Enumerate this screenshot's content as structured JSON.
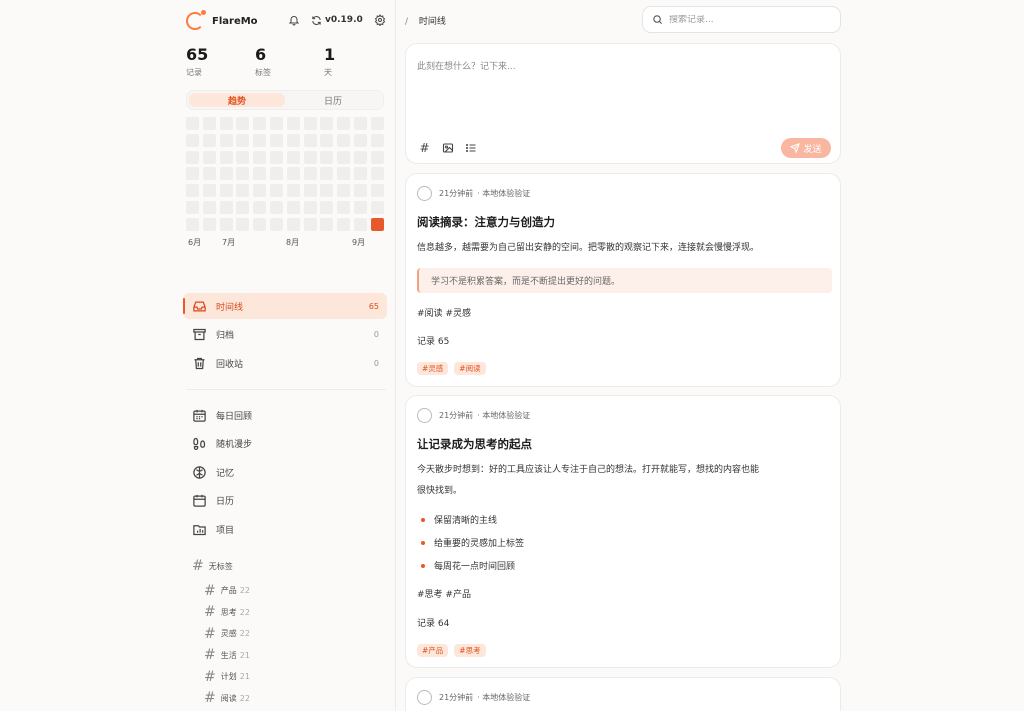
{
  "app": {
    "name": "FlareMo",
    "version": "v0.19.0"
  },
  "stats": [
    {
      "num": "65",
      "label": "记录"
    },
    {
      "num": "6",
      "label": "标签"
    },
    {
      "num": "1",
      "label": "天"
    }
  ],
  "view_toggle": {
    "trend": "趋势",
    "calendar": "日历"
  },
  "heatmap": {
    "hot_index": 83,
    "rows": 7,
    "cols": 12
  },
  "months": [
    "6月",
    "7月",
    "8月",
    "9月"
  ],
  "nav": [
    {
      "label": "时间线",
      "count": "65"
    },
    {
      "label": "归档",
      "count": "0"
    },
    {
      "label": "回收站",
      "count": "0"
    }
  ],
  "tools": [
    "每日回顾",
    "随机漫步",
    "记忆",
    "日历",
    "项目"
  ],
  "tags": {
    "heading": "无标签",
    "items": [
      {
        "name": "产品",
        "count": "22"
      },
      {
        "name": "思考",
        "count": "22"
      },
      {
        "name": "灵感",
        "count": "22"
      },
      {
        "name": "生活",
        "count": "21"
      },
      {
        "name": "计划",
        "count": "21"
      },
      {
        "name": "阅读",
        "count": "22"
      }
    ]
  },
  "header": {
    "breadcrumb_sep": "/",
    "title": "时间线",
    "search_placeholder": "搜索记录..."
  },
  "composer": {
    "placeholder": "此刻在想什么？记下来...",
    "send": "发送"
  },
  "cards": [
    {
      "time": "21分钟前",
      "source": "· 本地体验验证",
      "title": "阅读摘录：注意力与创造力",
      "text": "信息越多，越需要为自己留出安静的空间。把零散的观察记下来，连接就会慢慢浮现。",
      "quote": "学习不是积累答案，而是不断提出更好的问题。",
      "hashtags": "#阅读 #灵感",
      "record": "记录 65",
      "chips": [
        "#灵感",
        "#阅读"
      ]
    },
    {
      "time": "21分钟前",
      "source": "· 本地体验验证",
      "title": "让记录成为思考的起点",
      "text_line1": "今天散步时想到：好的工具应该让人专注于自己的想法。打开就能写，想找的内容也能",
      "text_line2": "很快找到。",
      "bullets": [
        "保留清晰的主线",
        "给重要的灵感加上标签",
        "每周花一点时间回顾"
      ],
      "hashtags": "#思考 #产品",
      "record": "记录 64",
      "chips": [
        "#产品",
        "#思考"
      ]
    },
    {
      "time": "21分钟前",
      "source": "· 本地体验验证"
    }
  ],
  "colors": {
    "accent": "#e8582a",
    "accent_soft": "#fde7da"
  }
}
